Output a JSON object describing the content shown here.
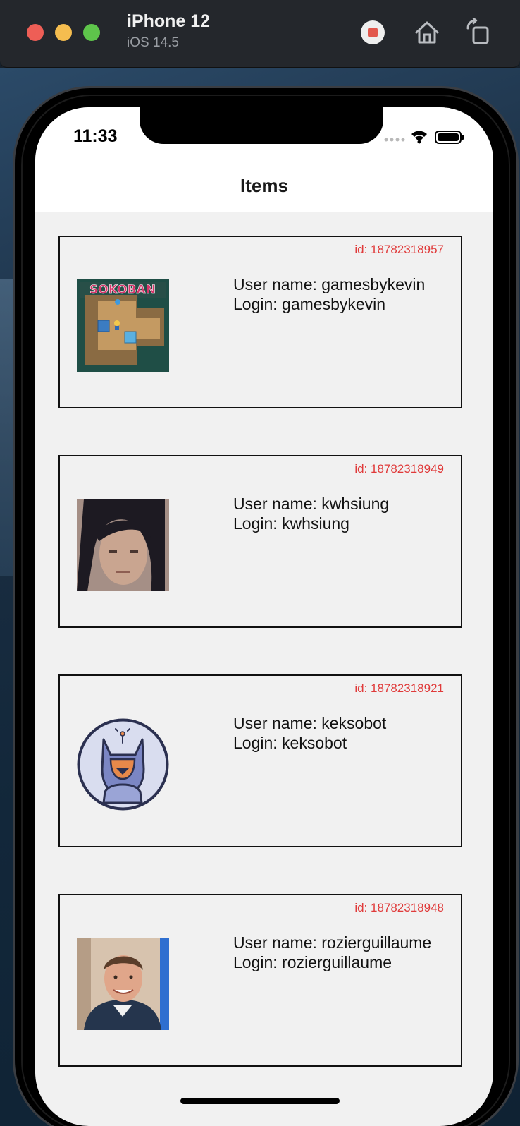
{
  "simulator": {
    "device_name": "iPhone 12",
    "os_version": "iOS 14.5",
    "buttons": [
      "stop-icon",
      "home-icon",
      "rotate-icon"
    ]
  },
  "status_bar": {
    "time": "11:33"
  },
  "nav": {
    "title": "Items"
  },
  "items": [
    {
      "id_text": "id: 18782318957",
      "user_name": "User name: gamesbykevin",
      "login": "Login: gamesbykevin",
      "avatar_icon": "sokoban-game-icon"
    },
    {
      "id_text": "id: 18782318949",
      "user_name": "User name: kwhsiung",
      "login": "Login: kwhsiung",
      "avatar_icon": "person-photo-icon"
    },
    {
      "id_text": "id: 18782318921",
      "user_name": "User name: keksobot",
      "login": "Login: keksobot",
      "avatar_icon": "robot-cat-icon"
    },
    {
      "id_text": "id: 18782318948",
      "user_name": "User name: rozierguillaume",
      "login": "Login: rozierguillaume",
      "avatar_icon": "person-photo-icon"
    }
  ],
  "colors": {
    "id_text": "#e03a3a",
    "screen_background": "#f1f1f1",
    "card_border": "#111111"
  }
}
